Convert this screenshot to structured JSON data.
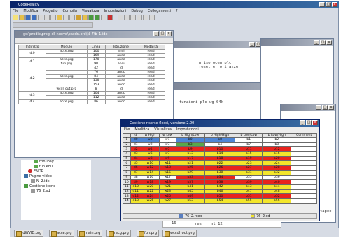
{
  "app": {
    "title": "CodeReality",
    "menu": [
      "File",
      "Modifica",
      "Progetto",
      "Compila",
      "Visualizza",
      "Impostazioni",
      "Debug",
      "Collegamenti",
      "?"
    ]
  },
  "colors": {
    "red": "#e8231e",
    "yellow": "#f3e62b",
    "white": "#ffffff",
    "blue": "#4f86d6",
    "green": "#5aa84a"
  },
  "index_window": {
    "title": "gs:\\prodio\\prog_dl_nuovo\\pacdn.ore\\N_7\\b_1.idx",
    "headers": [
      "Indirizzo",
      "Modulo",
      "Linea",
      "Istruzione",
      "Modalità"
    ],
    "groups": [
      {
        "addr": "d.0",
        "rows": [
          [
            "acce.prg",
            "100",
            "andi",
            "read"
          ],
          [
            "",
            "169",
            "andc",
            "read"
          ]
        ]
      },
      {
        "addr": "d.1",
        "rows": [
          [
            "acce.prg",
            "170",
            "andc",
            "read"
          ],
          [
            "fun.prg",
            "90",
            "andi",
            "read"
          ]
        ]
      },
      {
        "addr": "d.2",
        "rows": [
          [
            "",
            "42",
            "Id",
            "read"
          ],
          [
            "",
            "76",
            "andc",
            "read"
          ],
          [
            "acce.prg",
            "84",
            "andc",
            "read"
          ],
          [
            "",
            "130",
            "andc",
            "read"
          ],
          [
            "",
            "153",
            "andc",
            "read"
          ],
          [
            "wcdl_out.prg",
            "8",
            "Id",
            "read"
          ]
        ]
      },
      {
        "addr": "d.3",
        "rows": [
          [
            "acce.prg",
            "104",
            "andc",
            "read"
          ],
          [
            "",
            "112",
            "andc",
            "read"
          ]
        ]
      },
      {
        "addr": "d.4",
        "rows": [
          [
            "acce.prg",
            "86",
            "andc",
            "read"
          ]
        ]
      }
    ]
  },
  "code": {
    "lines1": [
      "priso ocen plc",
      "reset errori azze"
    ],
    "line2": "funzioni plc wg 04k",
    "footer_num": "16",
    "footer_code": "res    nl 12"
  },
  "tree": {
    "items": [
      "rrinuoay",
      "fun.equ",
      "ENDP",
      "Pagine video",
      "N_2.idx",
      "Gestione icone",
      "76_2.sd"
    ]
  },
  "grid_window": {
    "title": "Gestione risorse flessi, versione 2.00",
    "menu": [
      "File",
      "Modifica",
      "Visualizza",
      "Impostazioni"
    ],
    "headers": [
      "",
      "d",
      "w High",
      "w Low",
      "b High/Low",
      "b High/High",
      "b Low/Low",
      "b Low/High",
      "Comment"
    ],
    "rows": [
      {
        "n": "1",
        "c": [
          "d0",
          "w0",
          "w1",
          "b0",
          "b8",
          "b1",
          "b2",
          ""
        ],
        "k": [
          "b",
          "b",
          "w",
          "b",
          "b",
          "w",
          "w",
          "w"
        ]
      },
      {
        "n": "2",
        "c": [
          "d1",
          "w2",
          "w3",
          "b3",
          "b4",
          "b7",
          "b8",
          ""
        ],
        "k": [
          "w",
          "w",
          "w",
          "g",
          "w",
          "w",
          "w",
          "w"
        ]
      },
      {
        "n": "3",
        "c": [
          "d2",
          "w4",
          "w5",
          "b9",
          "b10",
          "b11",
          "b12",
          ""
        ],
        "k": [
          "r",
          "r",
          "r",
          "r",
          "r",
          "r",
          "r",
          "w"
        ]
      },
      {
        "n": "4",
        "c": [
          "d3",
          "w6",
          "w7",
          "b13",
          "b14",
          "b15",
          "b16",
          ""
        ],
        "k": [
          "y",
          "y",
          "y",
          "y",
          "y",
          "y",
          "y",
          "w"
        ]
      },
      {
        "n": "5",
        "c": [
          "d4",
          "w8",
          "w9",
          "b17",
          "b18",
          "b19",
          "b20",
          ""
        ],
        "k": [
          "r",
          "r",
          "r",
          "r",
          "r",
          "r",
          "r",
          "w"
        ]
      },
      {
        "n": "6",
        "c": [
          "d5",
          "w10",
          "w11",
          "b21",
          "b22",
          "b23",
          "b24",
          ""
        ],
        "k": [
          "y",
          "y",
          "y",
          "y",
          "y",
          "y",
          "y",
          "w"
        ]
      },
      {
        "n": "7",
        "c": [
          "d6",
          "w12",
          "w13",
          "b25",
          "b26",
          "b27",
          "b28",
          ""
        ],
        "k": [
          "r",
          "r",
          "r",
          "r",
          "r",
          "r",
          "r",
          "w"
        ]
      },
      {
        "n": "8",
        "c": [
          "d7",
          "w14",
          "w15",
          "b29",
          "b30",
          "b31",
          "b32",
          ""
        ],
        "k": [
          "y",
          "y",
          "y",
          "y",
          "y",
          "y",
          "y",
          "w"
        ]
      },
      {
        "n": "9",
        "c": [
          "d8",
          "w16",
          "w17",
          "b33",
          "b34",
          "b35",
          "b36",
          ""
        ],
        "k": [
          "w",
          "w",
          "w",
          "r",
          "r",
          "w",
          "w",
          "w"
        ]
      },
      {
        "n": "10",
        "c": [
          "d9",
          "w18",
          "w19",
          "b37",
          "b38",
          "b39",
          "b40",
          ""
        ],
        "k": [
          "r",
          "r",
          "r",
          "r",
          "r",
          "r",
          "r",
          "w"
        ]
      },
      {
        "n": "11",
        "c": [
          "d10",
          "w20",
          "w21",
          "b41",
          "b42",
          "b43",
          "b44",
          ""
        ],
        "k": [
          "y",
          "y",
          "y",
          "y",
          "y",
          "y",
          "y",
          "w"
        ]
      },
      {
        "n": "12",
        "c": [
          "d11",
          "w22",
          "w23",
          "b45",
          "b46",
          "b47",
          "b48",
          ""
        ],
        "k": [
          "y",
          "y",
          "y",
          "y",
          "y",
          "y",
          "y",
          "w"
        ]
      },
      {
        "n": "13",
        "c": [
          "d12",
          "w24",
          "w25",
          "b49",
          "b50",
          "b51",
          "b52",
          ""
        ],
        "k": [
          "r",
          "r",
          "r",
          "r",
          "r",
          "r",
          "r",
          "w"
        ]
      },
      {
        "n": "14",
        "c": [
          "d13",
          "w26",
          "w27",
          "b53",
          "b54",
          "b55",
          "b56",
          ""
        ],
        "k": [
          "y",
          "y",
          "y",
          "y",
          "y",
          "y",
          "y",
          "w"
        ]
      }
    ],
    "tabs": [
      "76_2.rsex",
      "76_2.sd"
    ]
  },
  "taskbar": [
    "idWVID.prg",
    "acce.prg",
    "main.prg",
    "recg.prg",
    "fun.prg",
    "wccdl_out.prg"
  ],
  "right_edge_text": "tapeo"
}
